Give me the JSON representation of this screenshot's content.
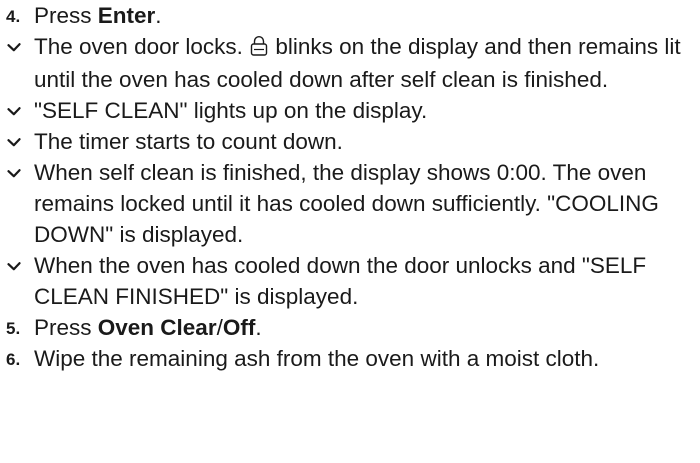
{
  "steps": [
    {
      "num": "4.",
      "text_before": "Press ",
      "bold": "Enter",
      "text_after": "."
    },
    {
      "num": "5.",
      "text_before": "Press ",
      "bold": "Oven Clear",
      "middle": "/",
      "bold2": "Off",
      "text_after": "."
    },
    {
      "num": "6.",
      "text": "Wipe the remaining ash from the oven with a moist cloth."
    }
  ],
  "results": [
    {
      "before_icon": "The oven door locks. ",
      "icon": "lock-icon",
      "after_icon": " blinks on the display and then remains lit until the oven has cooled down after self clean is finished."
    },
    {
      "text": "\"SELF CLEAN\" lights up on the display."
    },
    {
      "text": "The timer starts to count down."
    },
    {
      "text": "When self clean is finished, the display shows 0:00. The oven remains locked until it has cooled down sufficiently. \"COOLING DOWN\" is displayed."
    },
    {
      "text": "When the oven has cooled down the door unlocks and \"SELF CLEAN FINISHED\" is displayed."
    }
  ]
}
